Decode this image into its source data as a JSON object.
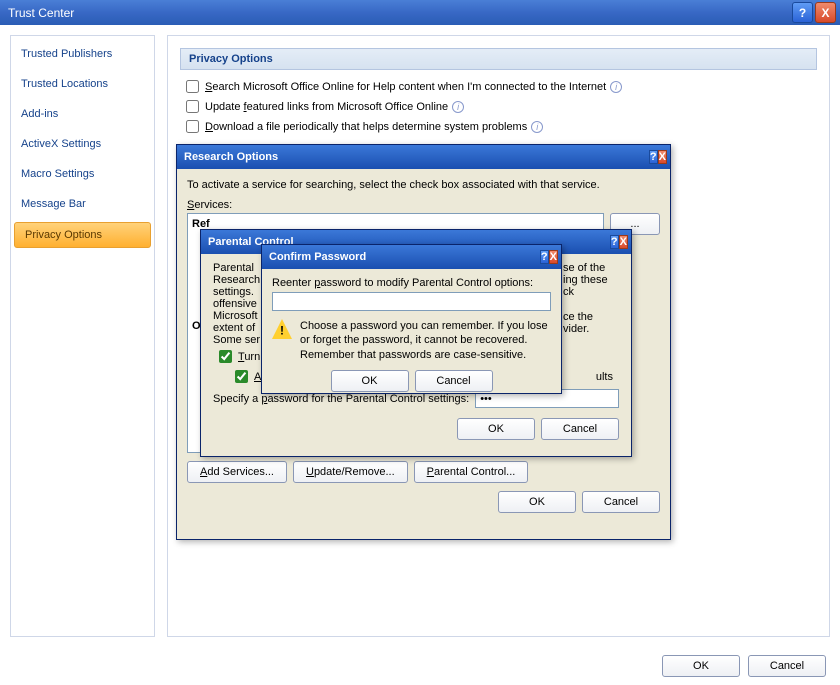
{
  "window": {
    "title": "Trust Center",
    "help": "?",
    "close": "X"
  },
  "sidebar": {
    "items": [
      "Trusted Publishers",
      "Trusted Locations",
      "Add-ins",
      "ActiveX Settings",
      "Macro Settings",
      "Message Bar",
      "Privacy Options"
    ],
    "selected_index": 6
  },
  "content": {
    "section_title": "Privacy Options",
    "checks": [
      "Search Microsoft Office Online for Help content when I'm connected to the Internet",
      "Update featured links from Microsoft Office Online",
      "Download a file periodically that helps determine system problems"
    ],
    "partial_D": "D",
    "partial_R": "R"
  },
  "research": {
    "title": "Research Options",
    "instruction": "To activate a service for searching, select the check box associated with that service.",
    "services_label": "Services:",
    "ref_label": "Ref",
    "oth_label": "Oth",
    "btn_add": "Add Services...",
    "btn_update": "Update/Remove...",
    "btn_parental": "Parental Control...",
    "btn_ok": "OK",
    "btn_cancel": "Cancel",
    "ellipsis": "..."
  },
  "parental": {
    "title": "Parental Control",
    "line1": "Parental",
    "line2": "Research",
    "line3": "settings.",
    "line4": "offensive",
    "line5": "Microsoft",
    "line6": "extent of",
    "line7": "Some ser",
    "right1": "se of the",
    "right2": "ing these",
    "right3": "ck",
    "right4": "ce the",
    "right5": "vider.",
    "check1": "Turn",
    "check2": "A",
    "check2_end": "ults",
    "specify_label": "Specify a password for the Parental Control settings:",
    "password_value": "•••",
    "btn_ok": "OK",
    "btn_cancel": "Cancel"
  },
  "confirm": {
    "title": "Confirm Password",
    "label": "Reenter password to modify Parental Control options:",
    "warning": "Choose a password you can remember. If you lose or forget the password, it cannot be recovered. Remember that passwords are case-sensitive.",
    "btn_ok": "OK",
    "btn_cancel": "Cancel"
  },
  "footer": {
    "ok": "OK",
    "cancel": "Cancel"
  }
}
